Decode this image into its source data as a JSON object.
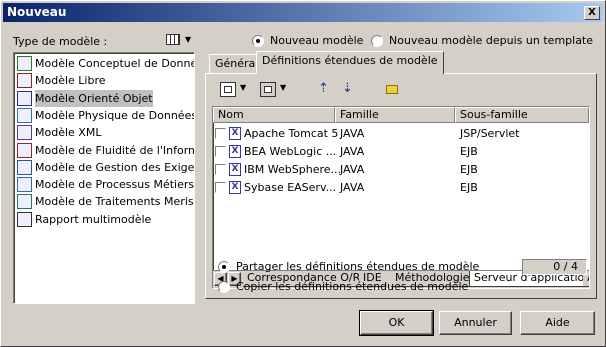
{
  "window": {
    "title": "Nouveau",
    "close_glyph": "X"
  },
  "model_type_label": "Type de modèle :",
  "view_toggle_icon": "grid-view-icon",
  "models": [
    {
      "label": "Modèle Conceptuel de Données",
      "icon": "mcd-icon",
      "selected": false
    },
    {
      "label": "Modèle Libre",
      "icon": "free-model-icon",
      "selected": false
    },
    {
      "label": "Modèle Orienté Objet",
      "icon": "oom-icon",
      "selected": true
    },
    {
      "label": "Modèle Physique de Données",
      "icon": "pdm-icon",
      "selected": false
    },
    {
      "label": "Modèle XML",
      "icon": "xml-icon",
      "selected": false
    },
    {
      "label": "Modèle de Fluidité de l'Information",
      "icon": "ilm-icon",
      "selected": false
    },
    {
      "label": "Modèle de Gestion des Exigences",
      "icon": "rq-icon",
      "selected": false
    },
    {
      "label": "Modèle de Processus Métiers",
      "icon": "bpm-icon",
      "selected": false
    },
    {
      "label": "Modèle de Traitements Merise",
      "icon": "merise-icon",
      "selected": false
    },
    {
      "label": "Rapport multimodèle",
      "icon": "report-icon",
      "selected": false
    }
  ],
  "creation_options": {
    "new_model": "Nouveau modèle",
    "new_from_template": "Nouveau modèle depuis un template",
    "selected": "new_model"
  },
  "tabs": [
    {
      "label": "Général",
      "active": false
    },
    {
      "label": "Définitions étendues de modèle",
      "active": true
    }
  ],
  "table": {
    "columns": [
      "Nom",
      "Famille",
      "Sous-famille"
    ],
    "rows": [
      {
        "name": "Apache Tomcat 5",
        "family": "JAVA",
        "subfamily": "JSP/Servlet",
        "checked": false
      },
      {
        "name": "BEA WebLogic ...",
        "family": "JAVA",
        "subfamily": "EJB",
        "checked": false
      },
      {
        "name": "IBM WebSphere...",
        "family": "JAVA",
        "subfamily": "EJB",
        "checked": false
      },
      {
        "name": "Sybase EAServ...",
        "family": "JAVA",
        "subfamily": "EJB",
        "checked": false
      }
    ]
  },
  "sub_tabs": [
    "Correspondance O/R",
    "IDE",
    "Méthodologie",
    "Serveur d'application",
    "A"
  ],
  "share_options": {
    "share": "Partager les définitions étendues de modèle",
    "copy": "Copier les définitions étendues de modèle",
    "selected": "share",
    "counter": "0 / 4"
  },
  "buttons": {
    "ok": "OK",
    "cancel": "Annuler",
    "help": "Aide"
  }
}
